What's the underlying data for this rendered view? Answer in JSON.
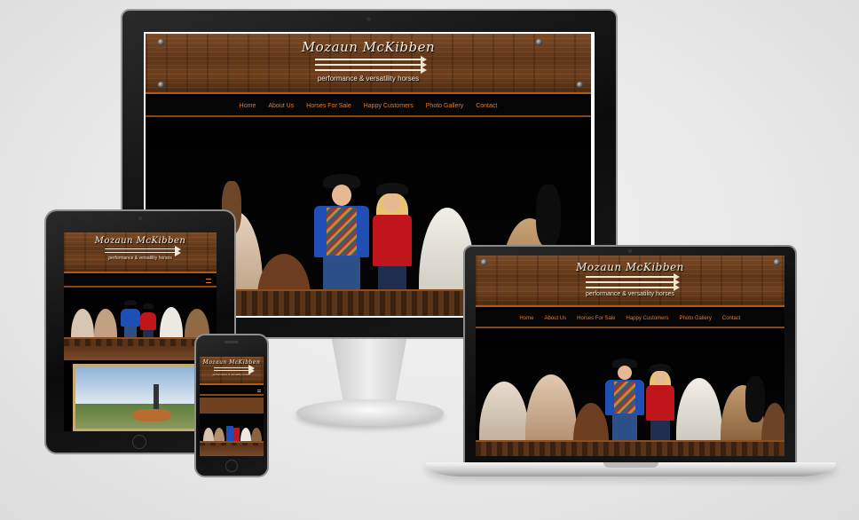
{
  "site": {
    "logo_name": "Mozaun McKibben",
    "logo_tagline": "performance & versatility horses"
  },
  "nav": {
    "items": [
      {
        "label": "Home"
      },
      {
        "label": "About Us"
      },
      {
        "label": "Horses For Sale"
      },
      {
        "label": "Happy Customers"
      },
      {
        "label": "Photo Gallery"
      },
      {
        "label": "Contact"
      }
    ]
  },
  "colors": {
    "nav_text": "#ea7b26",
    "wood": "#6e401e",
    "accent_border": "#b45a18",
    "background": "#e7e7e7"
  },
  "icons": [
    "camera-icon",
    "home-button-icon",
    "menu-icon"
  ]
}
